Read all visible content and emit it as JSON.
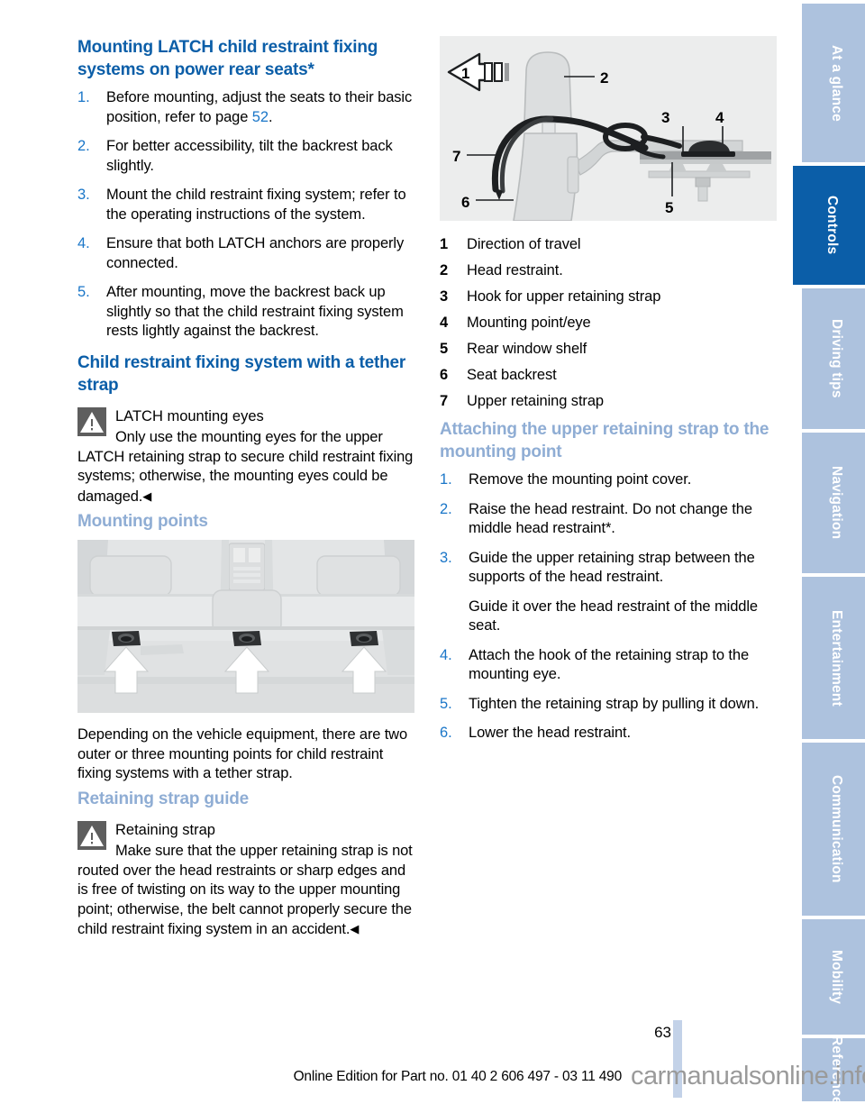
{
  "document": {
    "page_number": "63",
    "footer_note": "Online Edition for Part no. 01 40 2 606 497 - 03 11 490",
    "watermark": "carmanualsonline.info"
  },
  "colors": {
    "heading_dark_blue": "#0b5ea8",
    "heading_light_blue": "#8fadd4",
    "list_marker_blue": "#1a76c8",
    "tab_inactive": "#adc2de",
    "tab_active": "#0b5ea8",
    "figure_background": "#eceded",
    "warning_icon_background": "#5e5e5e"
  },
  "left_column": {
    "heading_1": "Mounting LATCH child restraint fixing systems on power rear seats*",
    "steps_1": [
      {
        "num": "1.",
        "text_before": "Before mounting, adjust the seats to their basic position, refer to page ",
        "page_ref": "52",
        "text_after": "."
      },
      {
        "num": "2.",
        "text_before": "For better accessibility, tilt the backrest back slightly.",
        "page_ref": "",
        "text_after": ""
      },
      {
        "num": "3.",
        "text_before": "Mount the child restraint fixing system; refer to the operating instructions of the system.",
        "page_ref": "",
        "text_after": ""
      },
      {
        "num": "4.",
        "text_before": "Ensure that both LATCH anchors are properly connected.",
        "page_ref": "",
        "text_after": ""
      },
      {
        "num": "5.",
        "text_before": "After mounting, move the backrest back up slightly so that the child restraint fixing system rests lightly against the backrest.",
        "page_ref": "",
        "text_after": ""
      }
    ],
    "heading_2": "Child restraint fixing system with a tether strap",
    "warning_1": {
      "icon": "warning-triangle-icon",
      "title": "LATCH mounting eyes",
      "body": "Only use the mounting eyes for the upper LATCH retaining strap to secure child restraint fixing systems; otherwise, the mounting eyes could be damaged.",
      "end_mark": "◀"
    },
    "heading_3": "Mounting points",
    "figure_1": {
      "name": "mounting-points-photo",
      "caption": "Rear parcel shelf showing three tether strap mounting points indicated by white arrows"
    },
    "paragraph_1": "Depending on the vehicle equipment, there are two outer or three mounting points for child restraint fixing systems with a tether strap.",
    "heading_4": "Retaining strap guide",
    "warning_2": {
      "icon": "warning-triangle-icon",
      "title": "Retaining strap",
      "body": "Make sure that the upper retaining strap is not routed over the head restraints or sharp edges and is free of twisting on its way to the upper mounting point; otherwise, the belt cannot properly secure the child restraint fixing system in an accident.",
      "end_mark": "◀"
    }
  },
  "right_column": {
    "figure_2": {
      "name": "retaining-strap-diagram",
      "caption": "Side view of seat backrest, head restraint, upper retaining strap, hook and mounting eye on rear window shelf",
      "callouts": [
        "1",
        "2",
        "3",
        "4",
        "5",
        "6",
        "7"
      ]
    },
    "legend": [
      {
        "num": "1",
        "label": "Direction of travel"
      },
      {
        "num": "2",
        "label": "Head restraint."
      },
      {
        "num": "3",
        "label": "Hook for upper retaining strap"
      },
      {
        "num": "4",
        "label": "Mounting point/eye"
      },
      {
        "num": "5",
        "label": "Rear window shelf"
      },
      {
        "num": "6",
        "label": "Seat backrest"
      },
      {
        "num": "7",
        "label": "Upper retaining strap"
      }
    ],
    "heading_1": "Attaching the upper retaining strap to the mounting point",
    "steps_1": [
      {
        "num": "1.",
        "text": "Remove the mounting point cover.",
        "sub": ""
      },
      {
        "num": "2.",
        "text": "Raise the head restraint. Do not change the middle head restraint*.",
        "sub": ""
      },
      {
        "num": "3.",
        "text": "Guide the upper retaining strap between the supports of the head restraint.",
        "sub": "Guide it over the head restraint of the middle seat."
      },
      {
        "num": "4.",
        "text": "Attach the hook of the retaining strap to the mounting eye.",
        "sub": ""
      },
      {
        "num": "5.",
        "text": "Tighten the retaining strap by pulling it down.",
        "sub": ""
      },
      {
        "num": "6.",
        "text": "Lower the head restraint.",
        "sub": ""
      }
    ]
  },
  "side_tabs": [
    {
      "label": "At a glance",
      "active": false
    },
    {
      "label": "Controls",
      "active": true
    },
    {
      "label": "Driving tips",
      "active": false
    },
    {
      "label": "Navigation",
      "active": false
    },
    {
      "label": "Entertainment",
      "active": false
    },
    {
      "label": "Communication",
      "active": false
    },
    {
      "label": "Mobility",
      "active": false
    },
    {
      "label": "Reference",
      "active": false
    }
  ]
}
